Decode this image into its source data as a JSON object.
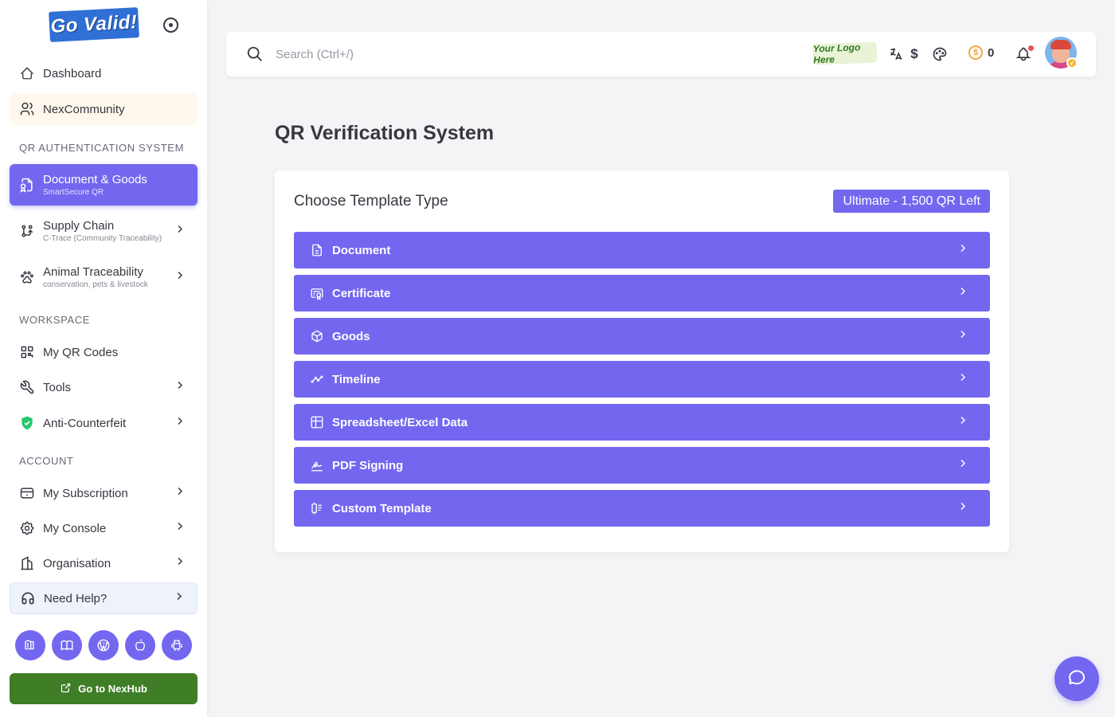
{
  "brand": {
    "logo_text": "Go Valid!"
  },
  "sidebar": {
    "top_items": [
      {
        "label": "Dashboard",
        "icon": "home-icon"
      },
      {
        "label": "NexCommunity",
        "icon": "users-icon"
      }
    ],
    "sections": {
      "qr": "QR AUTHENTICATION SYSTEM",
      "workspace": "WORKSPACE",
      "account": "ACCOUNT"
    },
    "qr_items": [
      {
        "label": "Document & Goods",
        "sub": "SmartSecure QR",
        "icon": "file-certificate-icon"
      },
      {
        "label": "Supply Chain",
        "sub": "C-Trace (Community Traceability)",
        "icon": "git-branch-icon"
      },
      {
        "label": "Animal Traceability",
        "sub": "conservation, pets & livestock",
        "icon": "paw-icon"
      }
    ],
    "workspace_items": [
      {
        "label": "My QR Codes",
        "icon": "qrcode-icon"
      },
      {
        "label": "Tools",
        "icon": "wrench-icon"
      },
      {
        "label": "Anti-Counterfeit",
        "icon": "shield-check-icon"
      }
    ],
    "account_items": [
      {
        "label": "My Subscription",
        "icon": "credit-card-icon"
      },
      {
        "label": "My Console",
        "icon": "settings-icon"
      },
      {
        "label": "Organisation",
        "icon": "building-icon"
      },
      {
        "label": "Need Help?",
        "icon": "headphones-icon"
      }
    ],
    "apps": [
      "office-icon",
      "book-icon",
      "wordpress-icon",
      "apple-icon",
      "android-icon"
    ],
    "nexhub_label": "Go to NexHub"
  },
  "topbar": {
    "search_placeholder": "Search (Ctrl+/)",
    "your_logo": "Your Logo Here",
    "currency": "$",
    "credits": "0"
  },
  "main": {
    "title": "QR Verification System",
    "card_title": "Choose Template Type",
    "plan_badge": "Ultimate - 1,500 QR Left",
    "templates": [
      {
        "label": "Document",
        "icon": "file-text-icon"
      },
      {
        "label": "Certificate",
        "icon": "certificate-icon"
      },
      {
        "label": "Goods",
        "icon": "box-icon"
      },
      {
        "label": "Timeline",
        "icon": "timeline-icon"
      },
      {
        "label": "Spreadsheet/Excel Data",
        "icon": "table-icon"
      },
      {
        "label": "PDF Signing",
        "icon": "signature-icon"
      },
      {
        "label": "Custom Template",
        "icon": "template-icon"
      }
    ]
  },
  "colors": {
    "primary": "#7367f0",
    "nexhub": "#3f7d26",
    "text": "#3a3541"
  }
}
